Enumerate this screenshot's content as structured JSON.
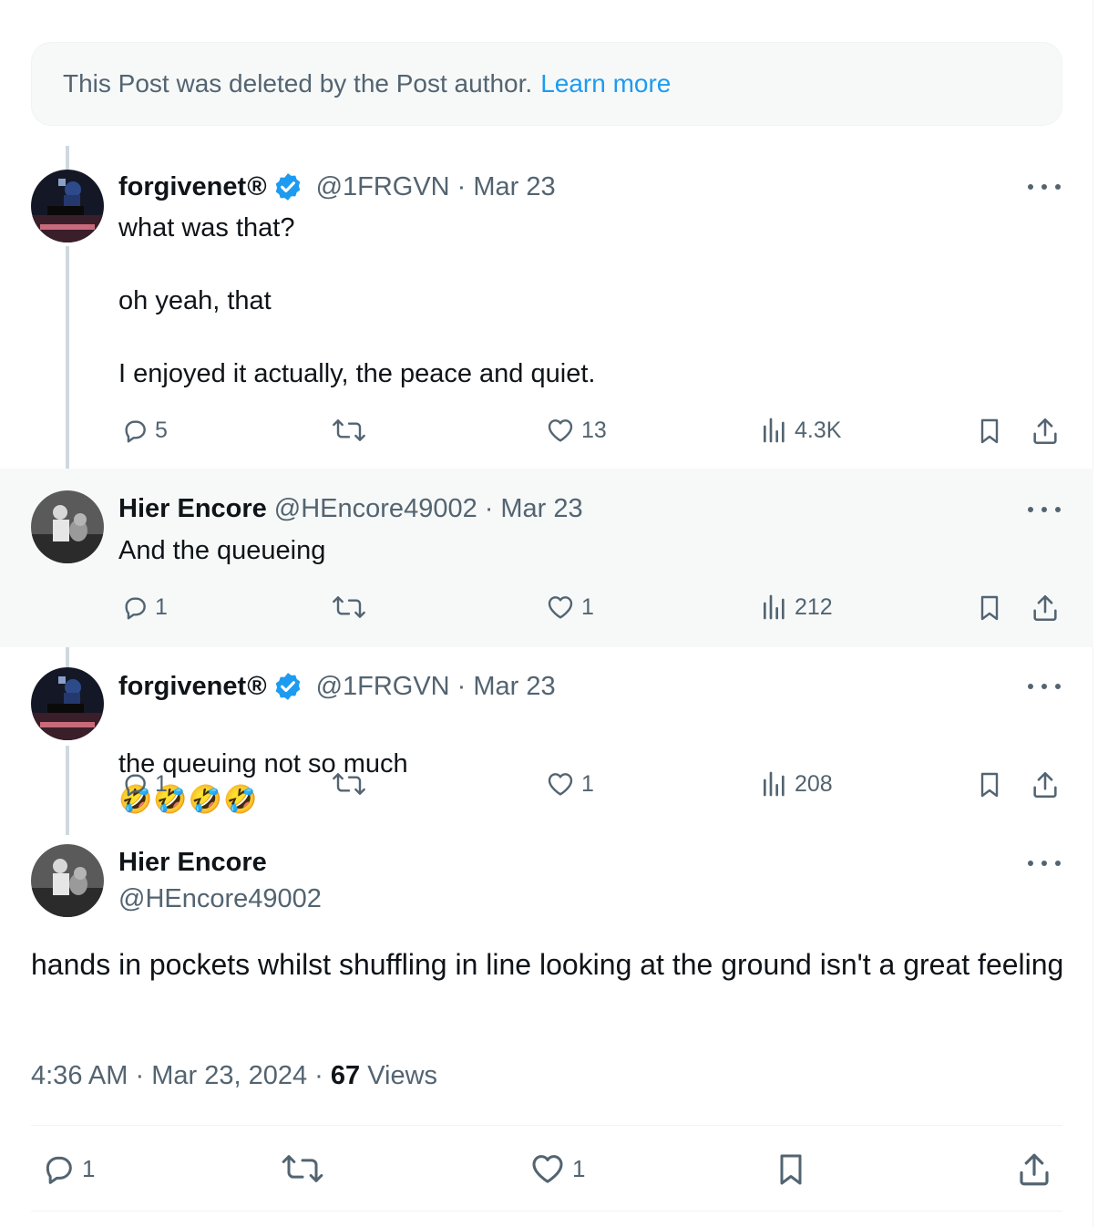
{
  "deleted_notice": {
    "text": "This Post was deleted by the Post author.",
    "link": "Learn more"
  },
  "posts": [
    {
      "name": "forgivenet",
      "reg_mark": "®",
      "verified": true,
      "handle": "@1FRGVN",
      "date": "Mar 23",
      "text": "what was that?\n\noh yeah, that\n\nI enjoyed it actually, the peace and quiet.",
      "replies": "5",
      "likes": "13",
      "views": "4.3K"
    },
    {
      "name": "Hier Encore",
      "handle": "@HEncore49002",
      "date": "Mar 23",
      "text": "And the queueing",
      "replies": "1",
      "likes": "1",
      "views": "212"
    },
    {
      "name": "forgivenet",
      "reg_mark": "®",
      "verified": true,
      "handle": "@1FRGVN",
      "date": "Mar 23",
      "text": "the queuing not so much",
      "emoji": "🤣🤣🤣🤣",
      "replies": "1",
      "likes": "1",
      "views": "208"
    }
  ],
  "main_post": {
    "name": "Hier Encore",
    "handle": "@HEncore49002",
    "text": "hands in pockets whilst shuffling in line looking at the ground isn't a great feeling",
    "time": "4:36 AM",
    "date": "Mar 23, 2024",
    "views_count": "67",
    "views_label": "Views",
    "replies": "1",
    "likes": "1"
  },
  "separator": "·",
  "colors": {
    "accent": "#1d9bf0",
    "text": "#0f1419",
    "muted": "#536471",
    "line": "#cfd9de",
    "highlight": "#f7f9f9"
  },
  "icons": [
    "reply-icon",
    "repost-icon",
    "like-icon",
    "views-icon",
    "bookmark-icon",
    "share-icon",
    "more-icon",
    "verified-badge-icon"
  ]
}
